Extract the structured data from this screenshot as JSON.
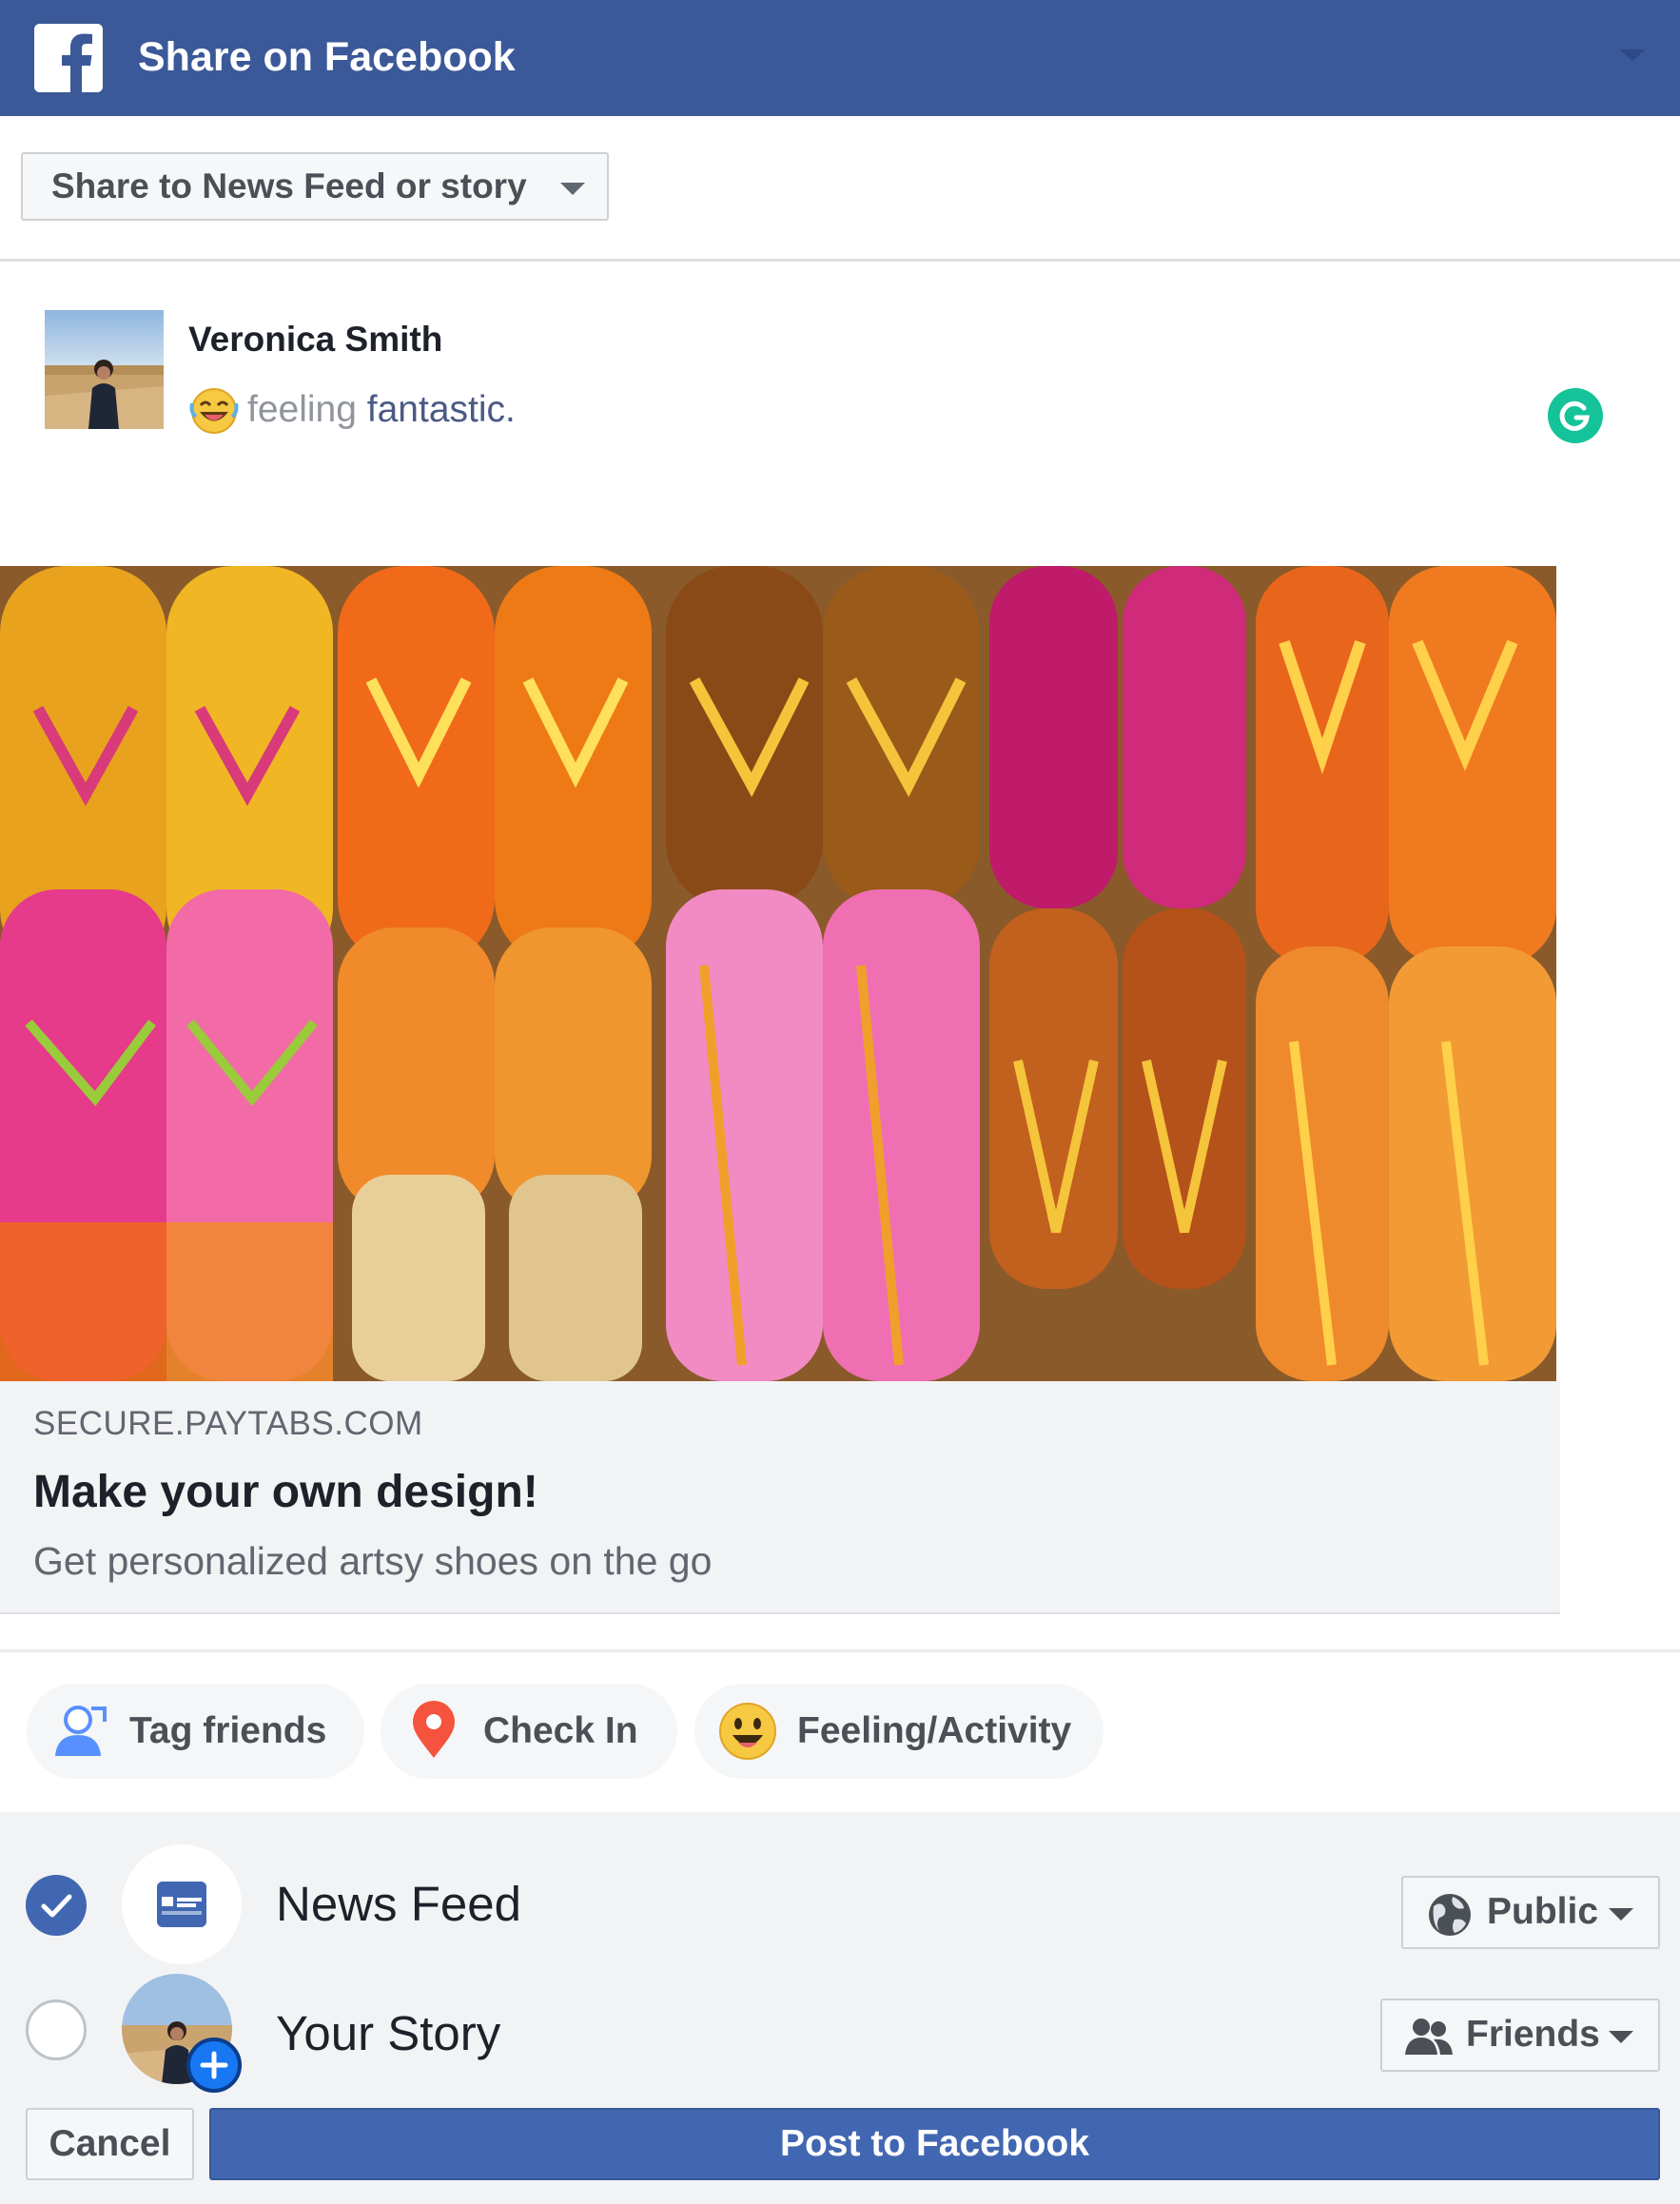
{
  "header": {
    "title": "Share on Facebook"
  },
  "share_target": {
    "label": "Share to News Feed or story"
  },
  "author": {
    "name": "Veronica Smith",
    "feeling_prefix": "feeling",
    "feeling_value": "fantastic."
  },
  "link_preview": {
    "domain": "SECURE.PAYTABS.COM",
    "title": "Make your own design!",
    "description": "Get personalized artsy shoes on the go"
  },
  "actions": [
    {
      "label": "Tag friends",
      "icon": "tag-friends-icon"
    },
    {
      "label": "Check In",
      "icon": "location-pin-icon"
    },
    {
      "label": "Feeling/Activity",
      "icon": "smiley-icon"
    }
  ],
  "destinations": [
    {
      "label": "News Feed",
      "checked": true,
      "privacy": "Public",
      "privacy_icon": "globe-icon"
    },
    {
      "label": "Your Story",
      "checked": false,
      "privacy": "Friends",
      "privacy_icon": "friends-icon"
    }
  ],
  "buttons": {
    "cancel": "Cancel",
    "post": "Post to Facebook"
  },
  "colors": {
    "brand": "#3b5998",
    "primary_button": "#4267b2",
    "grammarly": "#15c39a"
  }
}
